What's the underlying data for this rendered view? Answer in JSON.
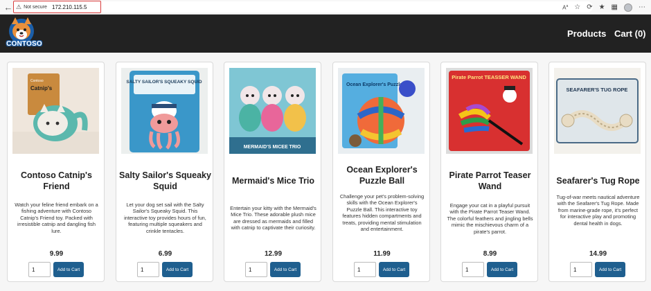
{
  "browser": {
    "security_label": "Not secure",
    "address": "172.210.115.5"
  },
  "header": {
    "logo_text": "CONTOSO",
    "nav": {
      "products": "Products",
      "cart": "Cart (0)"
    }
  },
  "products": [
    {
      "name": "Contoso Catnip's Friend",
      "description": "Watch your feline friend embark on a fishing adventure with Contoso Catnip's Friend toy. Packed with irresistible catnip and dangling fish lure.",
      "price": "9.99",
      "qty": "1",
      "add_label": "Add to Cart",
      "package_text": "Catnip's",
      "package_brand": "Contoso"
    },
    {
      "name": "Salty Sailor's Squeaky Squid",
      "description": "Let your dog set sail with the Salty Sailor's Squeaky Squid. This interactive toy provides hours of fun, featuring multiple squeakers and crinkle tentacles.",
      "price": "6.99",
      "qty": "1",
      "add_label": "Add to Cart",
      "package_text": "SALTY SAILOR'S SQUEAKY SQUID"
    },
    {
      "name": "Mermaid's Mice Trio",
      "description": "Entertain your kitty with the Mermaid's Mice Trio. These adorable plush mice are dressed as mermaids and filled with catnip to captivate their curiosity.",
      "price": "12.99",
      "qty": "1",
      "add_label": "Add to Cart",
      "package_text": "MERMAID'S MICEE TRIO"
    },
    {
      "name": "Ocean Explorer's Puzzle Ball",
      "description": "Challenge your pet's problem-solving skills with the Ocean Explorer's Puzzle Ball. This interactive toy features hidden compartments and treats, providing mental stimulation and entertainment.",
      "price": "11.99",
      "qty": "1",
      "add_label": "Add to Cart",
      "package_text": "Ocean Explorer's Puzzle Ball"
    },
    {
      "name": "Pirate Parrot Teaser Wand",
      "description": "Engage your cat in a playful pursuit with the Pirate Parrot Teaser Wand. The colorful feathers and jingling bells mimic the mischievous charm of a pirate's parrot.",
      "price": "8.99",
      "qty": "1",
      "add_label": "Add to Cart",
      "package_text": "Pirate Parrot TEASSER WAND"
    },
    {
      "name": "Seafarer's Tug Rope",
      "description": "Tug-of-war meets nautical adventure with the Seafarer's Tug Rope. Made from marine-grade rope, it's perfect for interactive play and promoting dental health in dogs.",
      "price": "14.99",
      "qty": "1",
      "add_label": "Add to Cart",
      "package_text": "SEAFARER'S TUG ROPE"
    }
  ],
  "colors": {
    "header_bg": "#222222",
    "button_bg": "#1f5f8f",
    "address_highlight": "#d83b3b"
  }
}
